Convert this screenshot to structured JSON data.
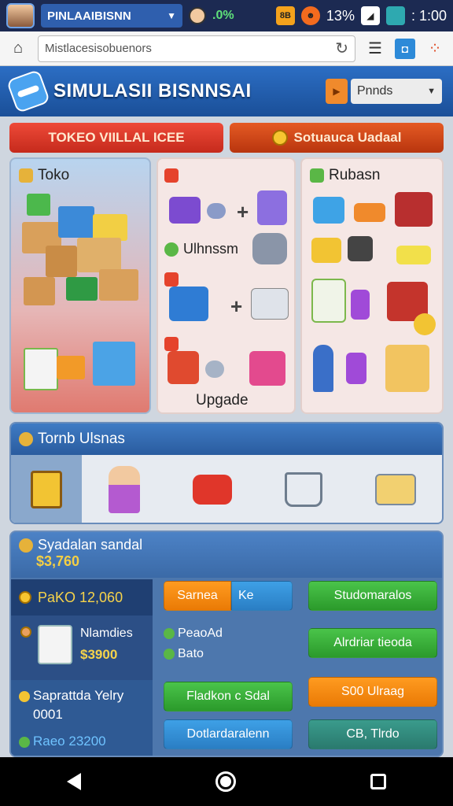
{
  "status_bar": {
    "tab_title": "PINLAAIBISNN",
    "percent_green": ".0%",
    "badge_text": "8B",
    "battery": "13%",
    "time": ": 1:00"
  },
  "browser": {
    "url": "Mistlacesisobuenors"
  },
  "app": {
    "title": "SIMULASII BISNNSAI",
    "select_value": "Pnnds"
  },
  "banners": {
    "left_label": "TOKEO VIILLAL ICEE",
    "right_label": "Sotuauca Uadaal"
  },
  "panels": {
    "toko_title": "Toko",
    "middle_label_1": "Ulhnssm",
    "middle_label_2": "Upgade",
    "right_title": "Rubasn"
  },
  "section_team": {
    "title": "Tornb Ulsnas"
  },
  "section_stats": {
    "title": "Syadalan sandal",
    "value": "$3,760",
    "stat_a": "PaKO 12,060",
    "stat_b_label": "Nlamdies",
    "stat_b_value": "$3900",
    "stat_c_label": "Saprattda Yelry",
    "stat_c_sub": "0001",
    "stat_c_value": "Raeo 23200",
    "buttons": {
      "sarnea": "Sarnea",
      "ke": "Ke",
      "studom": "Studomaralos",
      "peaoad": "PeaoAd",
      "bato": "Bato",
      "alrdriar": "Alrdriar tieoda",
      "fladkon": "Fladkon c Sdal",
      "s00": "S00 Ulraag",
      "dotlard": "Dotlardaralenn",
      "cb": "CB, Tlrdo"
    }
  }
}
